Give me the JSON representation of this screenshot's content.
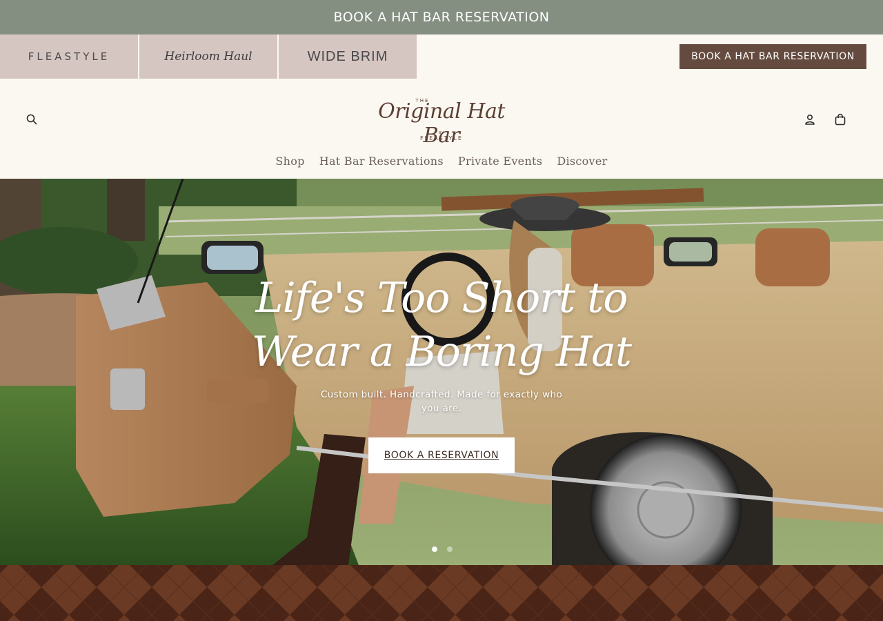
{
  "announcement": {
    "text": "BOOK A HAT BAR RESERVATION"
  },
  "brands": [
    {
      "label": "FLEASTYLE"
    },
    {
      "label": "Heirloom Haul"
    },
    {
      "label": "WIDE BRIM"
    }
  ],
  "top_cta": {
    "label": "BOOK A HAT BAR RESERVATION"
  },
  "header": {
    "logo": {
      "the": "THE",
      "main": "Original Hat Bar",
      "by": "BY",
      "sub": "FLEASTYLE"
    },
    "icons": {
      "search": "search-icon",
      "account": "account-icon",
      "cart": "cart-icon"
    }
  },
  "nav": {
    "items": [
      {
        "label": "Shop"
      },
      {
        "label": "Hat Bar Reservations"
      },
      {
        "label": "Private Events"
      },
      {
        "label": "Discover"
      }
    ]
  },
  "hero": {
    "title_line1": "Life's Too Short to",
    "title_line2": "Wear a Boring Hat",
    "subtitle": "Custom built. Handcrafted. Made for exactly who you are.",
    "cta": "BOOK A RESERVATION",
    "slide_active": 1,
    "slide_count": 2
  },
  "colors": {
    "announcement": "#848f82",
    "brand_tab": "#d6c6c2",
    "cta_brown": "#654b3f",
    "page": "#fbf8f2",
    "argyle_dark": "#4a2416",
    "argyle_light": "#6a3a24"
  }
}
